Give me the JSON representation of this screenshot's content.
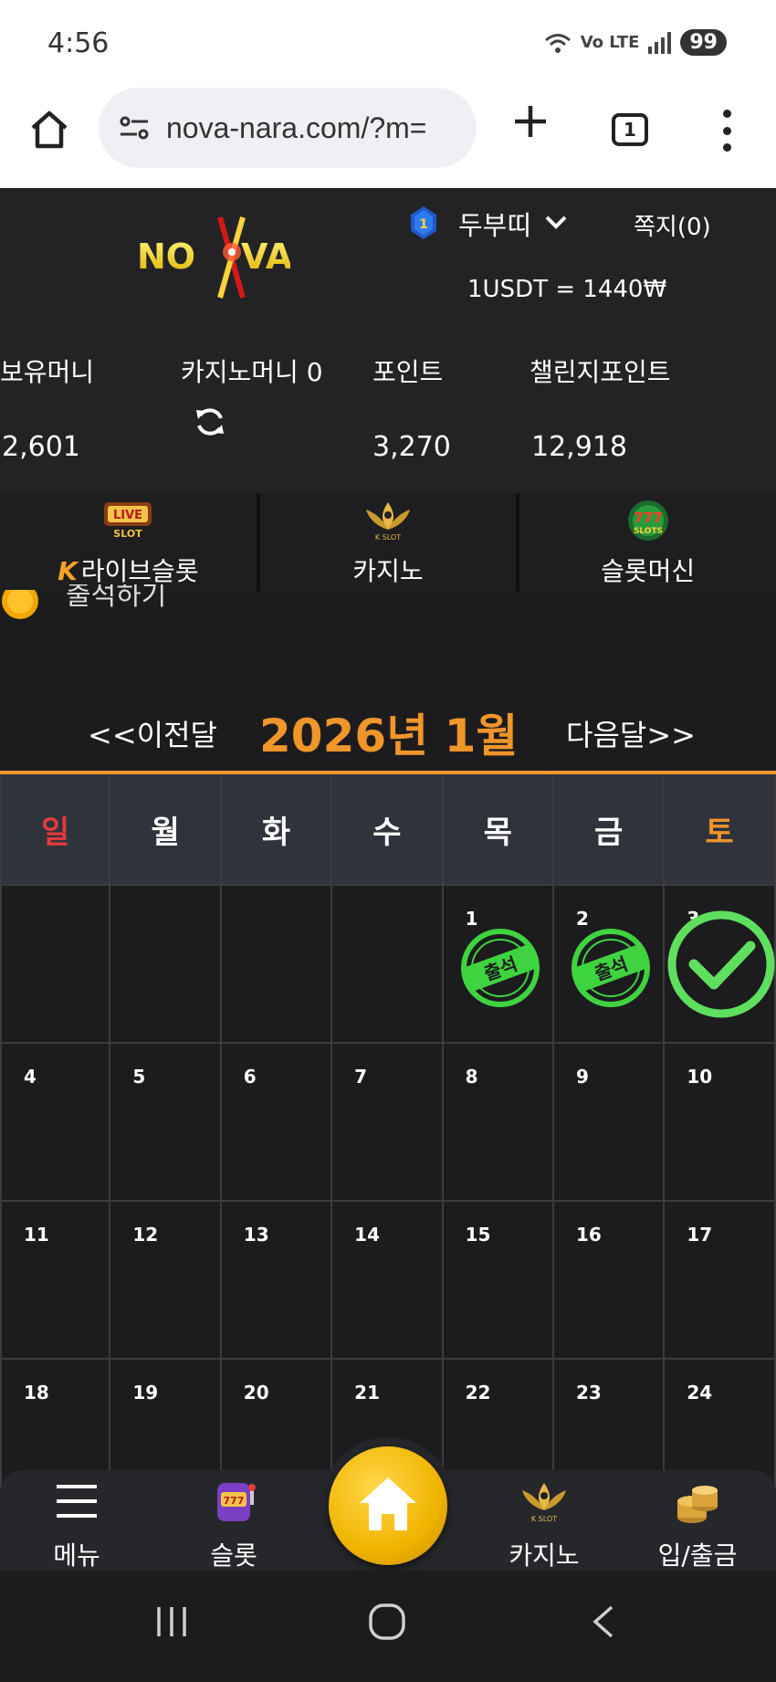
{
  "status_bar": {
    "time": "4:56",
    "network": "Vo LTE",
    "battery": "99"
  },
  "browser": {
    "url": "nova-nara.com/?m=",
    "tab_count": "1"
  },
  "header": {
    "logo_text": "NOVA",
    "username": "두부띠",
    "messages": "쪽지(0)",
    "exchange_rate": "1USDT = 1440₩",
    "balances": [
      {
        "label": "보유머니",
        "value": "2,601"
      },
      {
        "label": "카지노머니 0",
        "value": ""
      },
      {
        "label": "포인트",
        "value": "3,270"
      },
      {
        "label": "챌린지포인트",
        "value": "12,918"
      }
    ]
  },
  "game_tabs": [
    {
      "label": "라이브슬롯",
      "icon": "live-slot-icon",
      "prefix": "K"
    },
    {
      "label": "카지노",
      "icon": "k-slot-icon",
      "prefix": ""
    },
    {
      "label": "슬롯머신",
      "icon": "777-slots-icon",
      "prefix": ""
    }
  ],
  "attendance": {
    "title": "출석하기"
  },
  "calendar": {
    "prev_label": "<<이전달",
    "next_label": "다음달>>",
    "month_title": "2026년 1월",
    "weekdays": [
      "일",
      "월",
      "화",
      "수",
      "목",
      "금",
      "토"
    ],
    "weeks": [
      [
        "",
        "",
        "",
        "",
        "1",
        "2",
        "3"
      ],
      [
        "4",
        "5",
        "6",
        "7",
        "8",
        "9",
        "10"
      ],
      [
        "11",
        "12",
        "13",
        "14",
        "15",
        "16",
        "17"
      ],
      [
        "18",
        "19",
        "20",
        "21",
        "22",
        "23",
        "24"
      ]
    ],
    "stamp_text": "출석"
  },
  "bottom_nav": {
    "menu": "메뉴",
    "slot": "슬롯",
    "casino": "카지노",
    "deposit": "입/출금"
  },
  "colors": {
    "accent": "#f0952a",
    "header_bg": "#232326",
    "stamp_green": "#3fd43f",
    "sunday": "#e23b3b"
  }
}
